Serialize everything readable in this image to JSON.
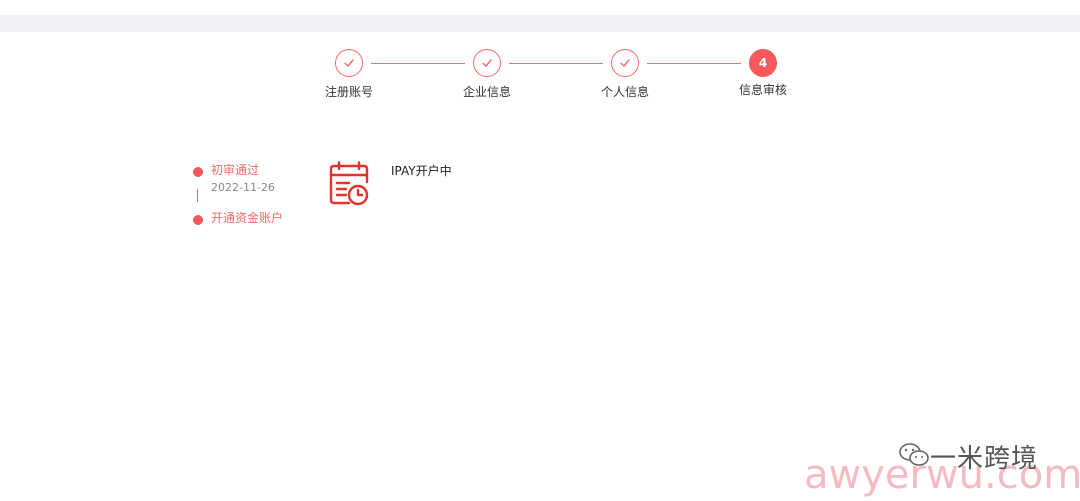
{
  "steps": [
    {
      "label": "注册账号",
      "state": "done"
    },
    {
      "label": "企业信息",
      "state": "done"
    },
    {
      "label": "个人信息",
      "state": "done"
    },
    {
      "label": "信息审核",
      "state": "current",
      "number": "4"
    }
  ],
  "timeline": {
    "items": [
      {
        "title": "初审通过",
        "date": "2022-11-26"
      },
      {
        "title": "开通资金账户"
      }
    ]
  },
  "status": {
    "text": "IPAY开户中",
    "icon": "calendar-clock-icon"
  },
  "watermark": {
    "brand": "一米跨境",
    "url": "awyerwu.com",
    "icon": "wechat-icon"
  },
  "colors": {
    "accent": "#f5595b",
    "accent_line": "#f26a6a",
    "text": "#333333",
    "muted": "#888888",
    "watermark_pink": "#f4b0b7"
  }
}
